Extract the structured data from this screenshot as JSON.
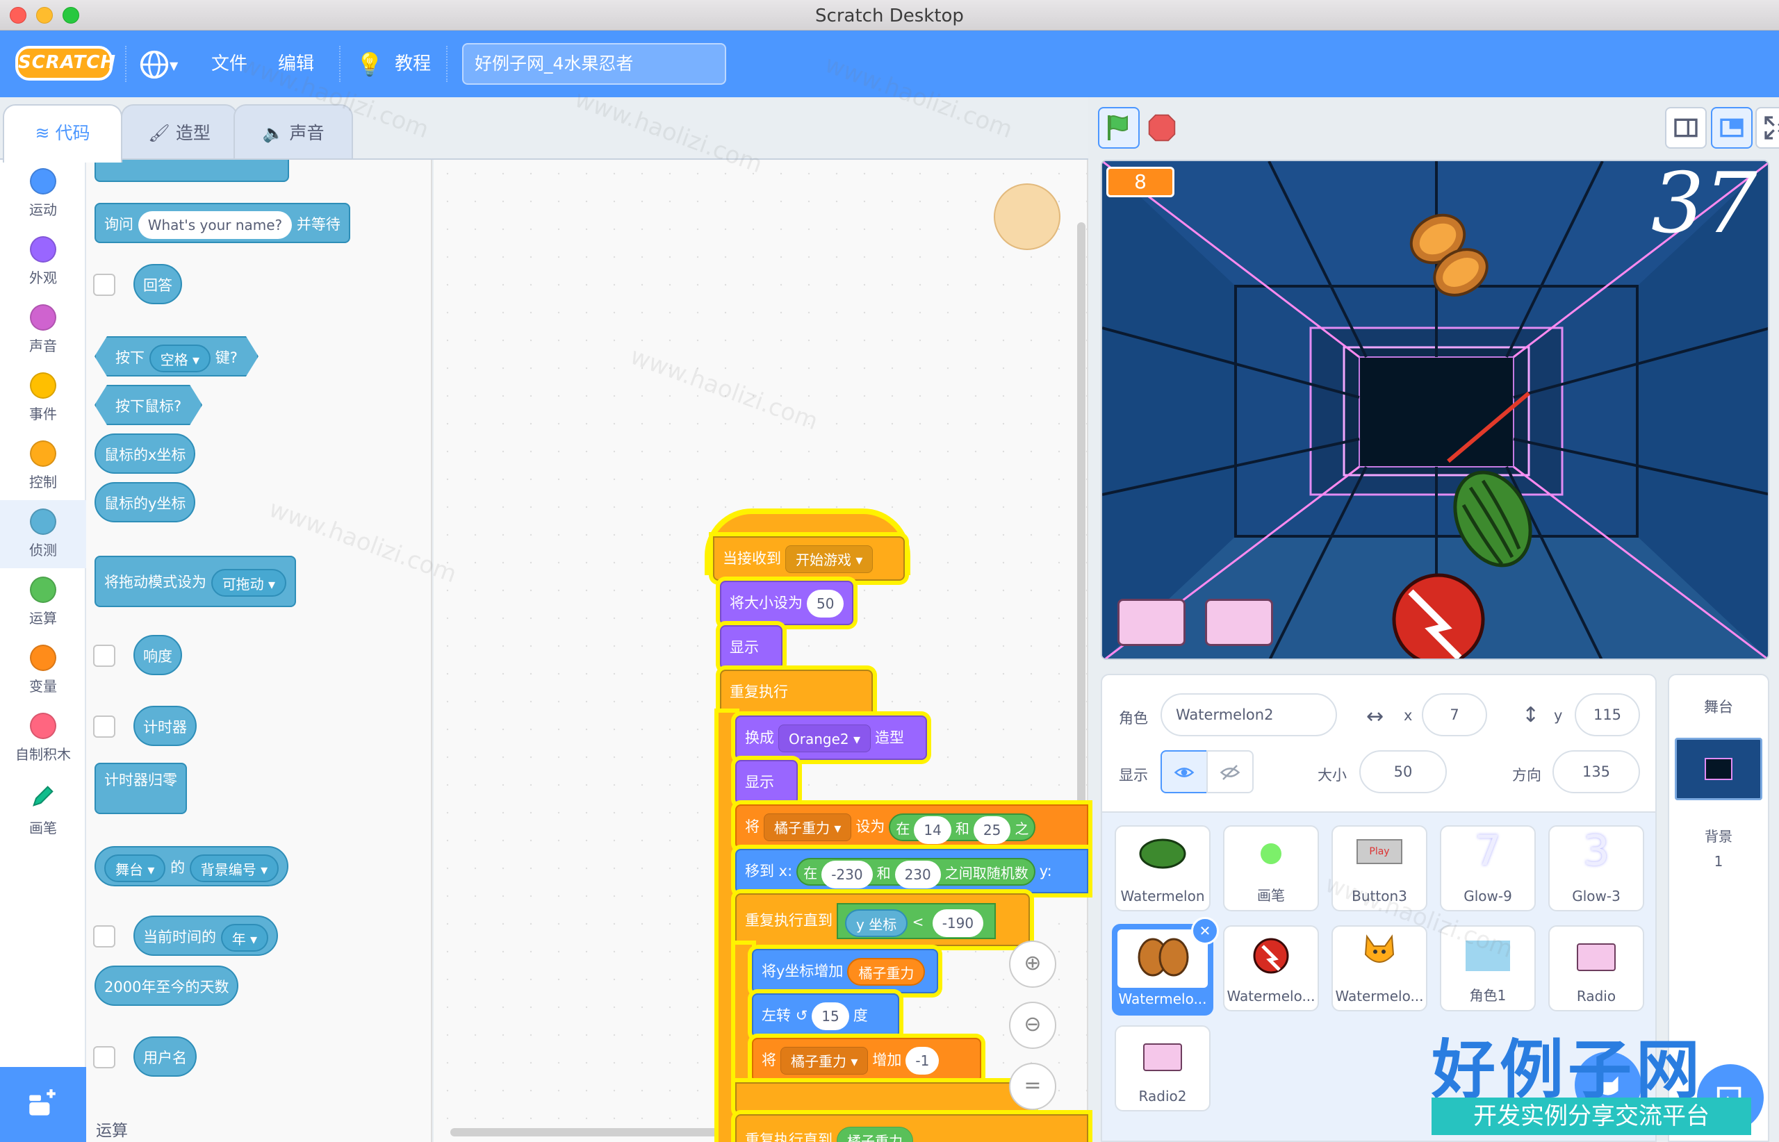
{
  "window": {
    "title": "Scratch Desktop"
  },
  "menubar": {
    "logo": "SCRATCH",
    "file": "文件",
    "edit": "编辑",
    "tutorials": "教程",
    "project_title": "好例子网_4水果忍者"
  },
  "tabs": {
    "code": "代码",
    "costumes": "造型",
    "sounds": "声音"
  },
  "categories": [
    {
      "label": "运动",
      "color": "#4c97ff"
    },
    {
      "label": "外观",
      "color": "#9966ff"
    },
    {
      "label": "声音",
      "color": "#cf63cf"
    },
    {
      "label": "事件",
      "color": "#ffbf00"
    },
    {
      "label": "控制",
      "color": "#ffab19"
    },
    {
      "label": "侦测",
      "color": "#5cb1d6"
    },
    {
      "label": "运算",
      "color": "#59c059"
    },
    {
      "label": "变量",
      "color": "#ff8c1a"
    },
    {
      "label": "自制积木",
      "color": "#ff6680"
    },
    {
      "label": "画笔",
      "color": "#0fbd8c"
    }
  ],
  "palette": {
    "ask": "询问",
    "ask_default": "What's your name?",
    "ask_wait": "并等待",
    "answer": "回答",
    "key_pressed": "按下",
    "key_option": "空格",
    "key_suffix": "键?",
    "mouse_down": "按下鼠标?",
    "mouse_x": "鼠标的x坐标",
    "mouse_y": "鼠标的y坐标",
    "drag_mode": "将拖动模式设为",
    "drag_option": "可拖动",
    "loudness": "响度",
    "timer": "计时器",
    "reset_timer": "计时器归零",
    "of_target": "舞台",
    "of_word": "的",
    "of_prop": "背景编号",
    "current": "当前时间的",
    "current_opt": "年",
    "days_since": "2000年至今的天数",
    "username": "用户名",
    "operators_heading": "运算"
  },
  "script": {
    "hat": "当接收到",
    "hat_msg": "开始游戏",
    "set_size": "将大小设为",
    "size_val": "50",
    "show": "显示",
    "forever": "重复执行",
    "switch_costume": "换成",
    "costume": "Orange2",
    "costume_suffix": "造型",
    "show2": "显示",
    "set_var": "将",
    "var_name": "橘子重力",
    "set_to": "设为",
    "rand_in": "在",
    "rand_a": "14",
    "rand_and": "和",
    "rand_b": "25",
    "rand_tail": "之",
    "goto": "移到 x:",
    "goto_in": "在",
    "goto_a": "-230",
    "goto_and": "和",
    "goto_b": "230",
    "goto_tail": "之间取随机数",
    "goto_y": "y:",
    "repeat_until": "重复执行直到",
    "ypos": "y 坐标",
    "lt": "<",
    "lt_val": "-190",
    "change_y": "将y坐标增加",
    "change_y_var": "橘子重力",
    "turn_left": "左转",
    "turn_val": "15",
    "deg": "度",
    "change_var": "将",
    "change_var_name": "橘子重力",
    "change_by": "增加",
    "change_val": "-1",
    "bottom_partial": "重复执行直到",
    "bottom_var": "橘子重力"
  },
  "stage": {
    "score_badge": "8",
    "big_number": "37"
  },
  "sprite_info": {
    "sprite_label": "角色",
    "sprite_name": "Watermelon2",
    "x_label": "x",
    "x": "7",
    "y_label": "y",
    "y": "115",
    "show_label": "显示",
    "size_label": "大小",
    "size": "50",
    "direction_label": "方向",
    "direction": "135"
  },
  "sprites": [
    {
      "name": "Watermelon",
      "icon": "watermelon-icon"
    },
    {
      "name": "画笔",
      "icon": "pen-dot-icon"
    },
    {
      "name": "Button3",
      "icon": "button-icon"
    },
    {
      "name": "Glow-9",
      "icon": "glow-9-icon"
    },
    {
      "name": "Glow-3",
      "icon": "glow-3-icon"
    },
    {
      "name": "Watermelo...",
      "icon": "orange-icon",
      "selected": true
    },
    {
      "name": "Watermelo...",
      "icon": "apple-icon"
    },
    {
      "name": "Watermelo...",
      "icon": "cat-icon"
    },
    {
      "name": "角色1",
      "icon": "card-icon"
    },
    {
      "name": "Radio",
      "icon": "radio-icon"
    },
    {
      "name": "Radio2",
      "icon": "radio-icon"
    }
  ],
  "stage_panel": {
    "title": "舞台",
    "backdrops_label": "背景",
    "backdrops_count": "1"
  },
  "button3_text": "Play",
  "watermark": {
    "site": "www.haolizi.com",
    "brand": "好例子网",
    "slogan": "开发实例分享交流平台"
  }
}
